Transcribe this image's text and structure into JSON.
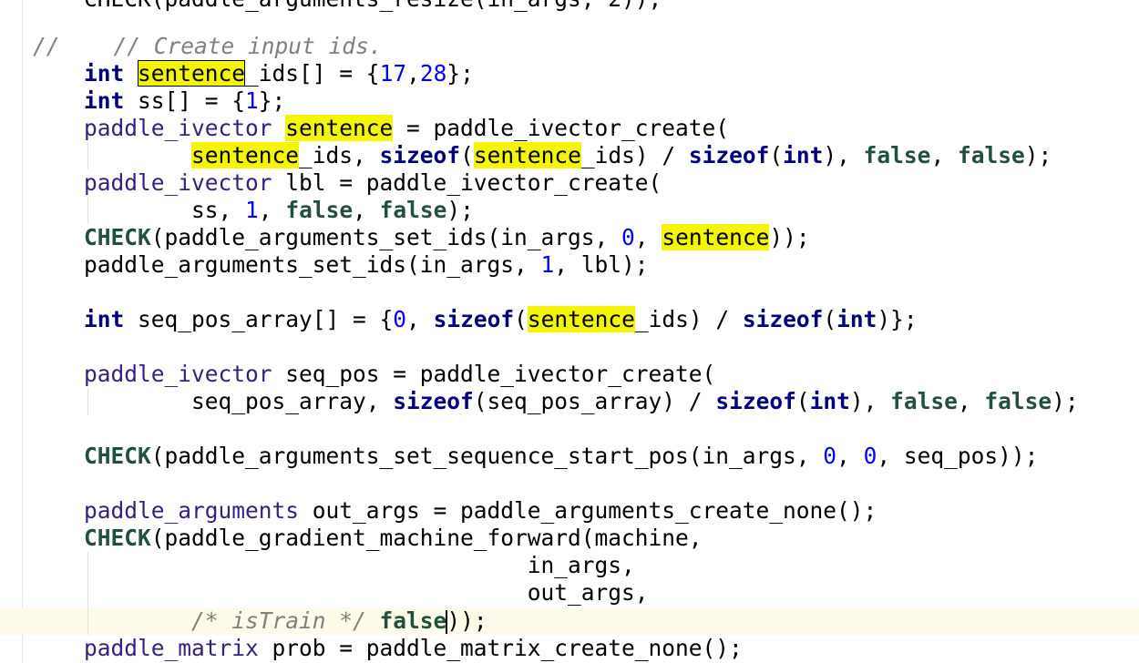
{
  "editor": {
    "top_partial": "CHECK(paddle_arguments_resize(in_args, 2));",
    "lines": {
      "l1": {
        "prefix": "//    ",
        "comment": "// Create input ids."
      },
      "l2": {
        "kw": "int",
        "hl": "sentence",
        "rest": "_ids[] = {",
        "n1": "17",
        "comma": ",",
        "n2": "28",
        "end": "};"
      },
      "l3": {
        "kw": "int",
        "mid": " ss[] = {",
        "n1": "1",
        "end": "};"
      },
      "l4": {
        "type": "paddle_ivector",
        "sp": " ",
        "hl": "sentence",
        "rest": " = paddle_ivector_create("
      },
      "l5": {
        "indent": "        ",
        "hl1": "sentence",
        "a": "_ids, ",
        "kw1": "sizeof",
        "b": "(",
        "hl2": "sentence",
        "c": "_ids) / ",
        "kw2": "sizeof",
        "d": "(",
        "kw3": "int",
        "e": "), ",
        "lit1": "false",
        "f": ", ",
        "lit2": "false",
        "g": ");"
      },
      "l6": {
        "type": "paddle_ivector",
        "rest": " lbl = paddle_ivector_create("
      },
      "l7": {
        "indent": "        ",
        "a": "ss, ",
        "n1": "1",
        "b": ", ",
        "lit1": "false",
        "c": ", ",
        "lit2": "false",
        "d": ");"
      },
      "l8": {
        "macro": "CHECK",
        "a": "(paddle_arguments_set_ids(in_args, ",
        "n1": "0",
        "b": ", ",
        "hl": "sentence",
        "c": "));"
      },
      "l9": {
        "a": "paddle_arguments_set_ids(in_args, ",
        "n1": "1",
        "b": ", lbl);"
      },
      "l10": {
        "kw": "int",
        "a": " seq_pos_array[] = {",
        "n1": "0",
        "b": ", ",
        "kw1": "sizeof",
        "c": "(",
        "hl": "sentence",
        "d": "_ids) / ",
        "kw2": "sizeof",
        "e": "(",
        "kw3": "int",
        "f": ")};"
      },
      "l11": {
        "type": "paddle_ivector",
        "rest": " seq_pos = paddle_ivector_create("
      },
      "l12": {
        "indent": "        ",
        "a": "seq_pos_array, ",
        "kw1": "sizeof",
        "b": "(seq_pos_array) / ",
        "kw2": "sizeof",
        "c": "(",
        "kw3": "int",
        "d": "), ",
        "lit1": "false",
        "e": ", ",
        "lit2": "false",
        "f": ");"
      },
      "l13": {
        "macro": "CHECK",
        "a": "(paddle_arguments_set_sequence_start_pos(in_args, ",
        "n1": "0",
        "b": ", ",
        "n2": "0",
        "c": ", seq_pos));"
      },
      "l14": {
        "type": "paddle_arguments",
        "rest": " out_args = paddle_arguments_create_none();"
      },
      "l15": {
        "macro": "CHECK",
        "a": "(paddle_gradient_machine_forward(machine,"
      },
      "l16": {
        "text": "                                 in_args,"
      },
      "l17": {
        "text": "                                 out_args,"
      },
      "l18": {
        "indent": "        ",
        "comment": "/* isTrain */",
        "sp": " ",
        "lit": "false",
        "end": "));"
      },
      "l19": {
        "type": "paddle_matrix",
        "rest": " prob = paddle_matrix_create_none();"
      }
    }
  }
}
